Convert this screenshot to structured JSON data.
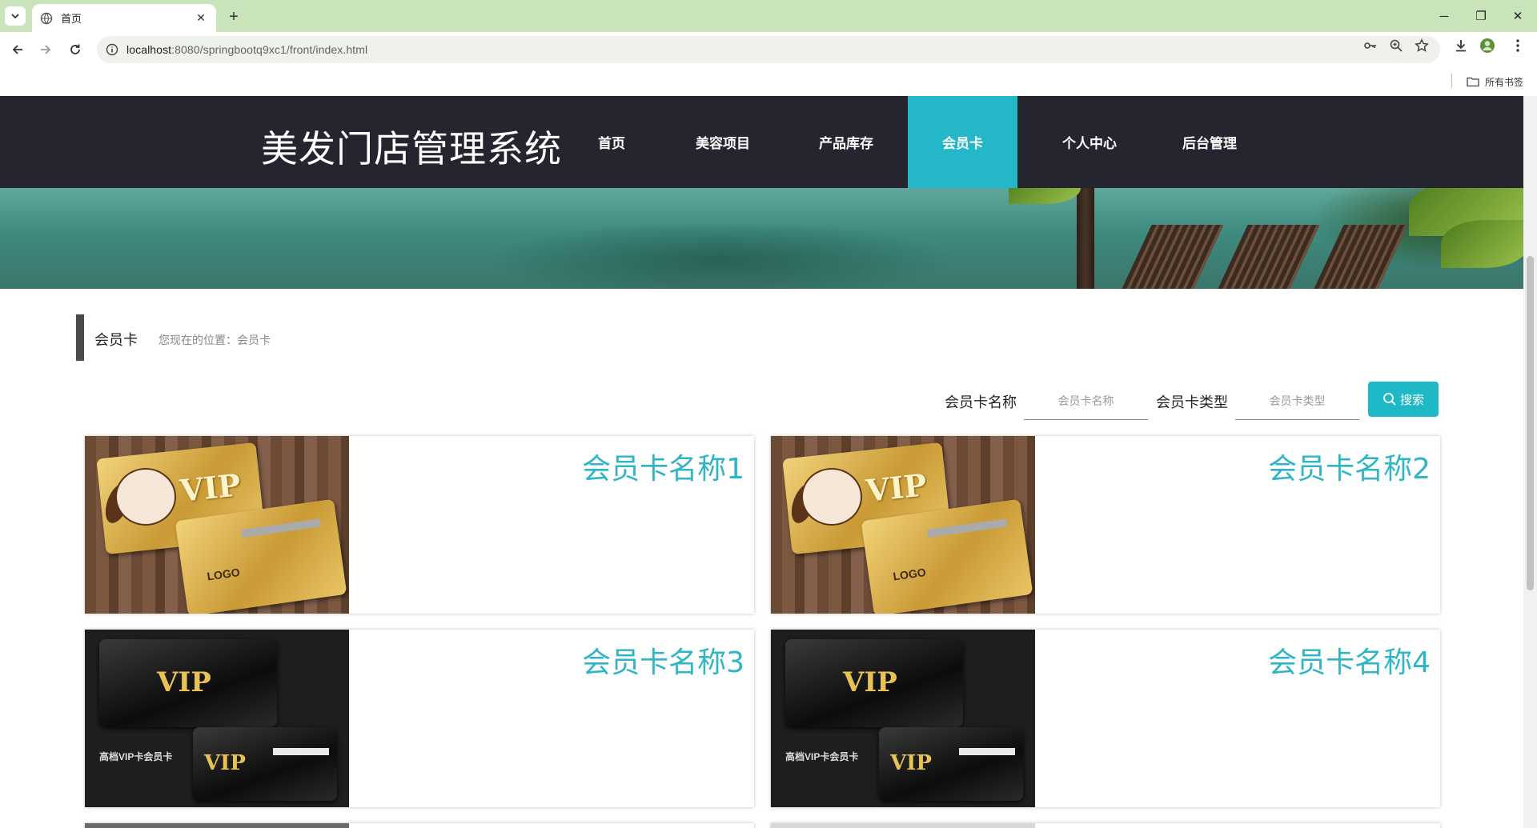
{
  "browser": {
    "tab_title": "首页",
    "url_host": "localhost",
    "url_rest": ":8080/springbootq9xc1/front/index.html",
    "bookmarks_all": "所有书签"
  },
  "site": {
    "title": "美发门店管理系统",
    "nav": [
      {
        "label": "首页"
      },
      {
        "label": "美容项目"
      },
      {
        "label": "产品库存"
      },
      {
        "label": "会员卡",
        "active": true
      },
      {
        "label": "个人中心"
      },
      {
        "label": "后台管理"
      }
    ],
    "accent_color": "#23b7c8",
    "header_color": "#24252f"
  },
  "breadcrumb": {
    "title": "会员卡",
    "path": "您现在的位置：会员卡"
  },
  "search": {
    "name_label": "会员卡名称",
    "name_placeholder": "会员卡名称",
    "type_label": "会员卡类型",
    "type_placeholder": "会员卡类型",
    "button_label": "搜索",
    "button_icon": "search-icon"
  },
  "cards": [
    {
      "name": "会员卡名称1",
      "image": "gold-vip-card"
    },
    {
      "name": "会员卡名称2",
      "image": "gold-vip-card"
    },
    {
      "name": "会员卡名称3",
      "image": "black-vip-card"
    },
    {
      "name": "会员卡名称4",
      "image": "black-vip-card"
    }
  ],
  "card_art": {
    "vip_text": "VIP",
    "logo_text": "LOGO",
    "black_caption": "高档VIP卡会员卡"
  }
}
